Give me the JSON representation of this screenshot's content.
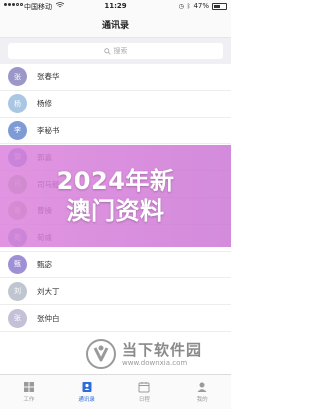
{
  "status_bar": {
    "carrier": "中国移动",
    "time": "11:29",
    "battery": "47%",
    "battery_level": 0.47
  },
  "nav": {
    "title": "通讯录"
  },
  "search": {
    "placeholder": "搜索"
  },
  "contacts": [
    {
      "initial": "张",
      "name": "张春华",
      "color": "#9c97c9"
    },
    {
      "initial": "杨",
      "name": "杨修",
      "color": "#a9c7e3"
    },
    {
      "initial": "李",
      "name": "李秘书",
      "color": "#7f9bd5"
    },
    {
      "initial": "郭",
      "name": "郭嘉",
      "color": "#6f8fd0"
    },
    {
      "initial": "司",
      "name": "司马懿",
      "color": "#9dc58f"
    },
    {
      "initial": "曹",
      "name": "曹操",
      "color": "#b6c39b"
    },
    {
      "initial": "荀",
      "name": "荀彧",
      "color": "#7aa0c7"
    },
    {
      "initial": "甄",
      "name": "甄宓",
      "color": "#9f8fd6"
    },
    {
      "initial": "刘",
      "name": "刘大丁",
      "color": "#bfc6d0"
    },
    {
      "initial": "张",
      "name": "张仲白",
      "color": "#c3c0d8"
    }
  ],
  "overlay": {
    "line1": "2024年新",
    "line2": "澳门资料"
  },
  "watermark": {
    "site_name": "当下软件园",
    "url": "www.downxia.com"
  },
  "tabs": [
    {
      "label": "工作",
      "icon": "grid-icon"
    },
    {
      "label": "通讯录",
      "icon": "contacts-icon",
      "active": true
    },
    {
      "label": "日程",
      "icon": "calendar-icon"
    },
    {
      "label": "我的",
      "icon": "person-icon"
    }
  ]
}
